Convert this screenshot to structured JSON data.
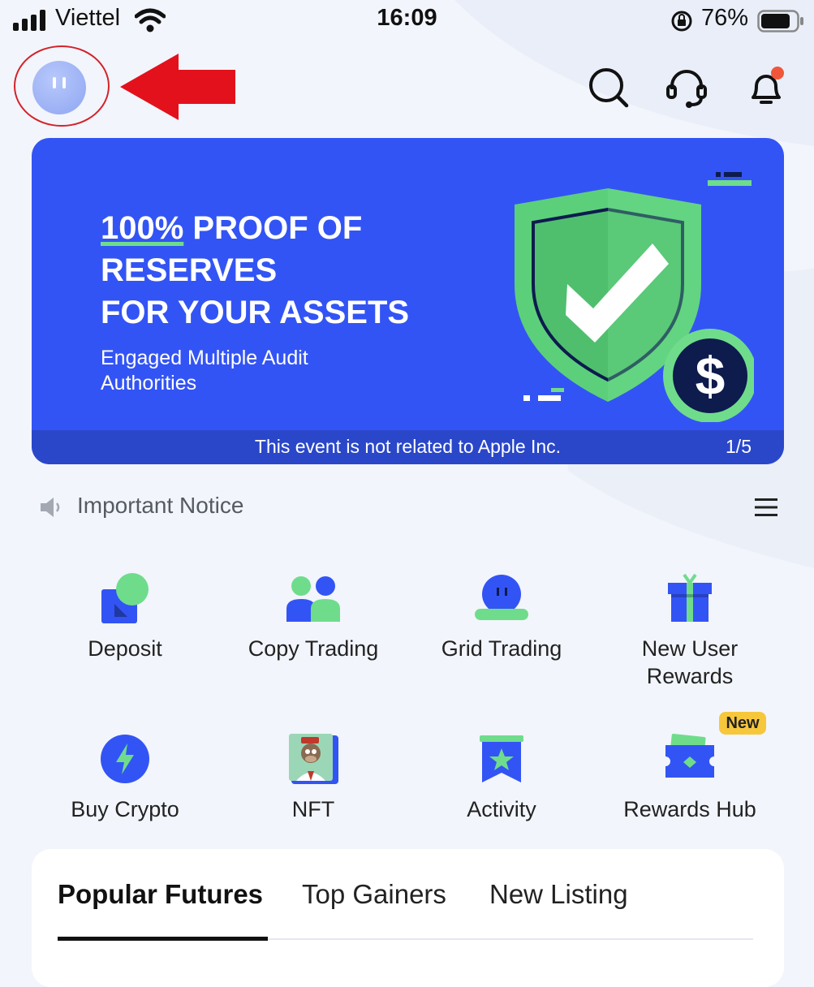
{
  "status_bar": {
    "carrier": "Viettel",
    "time": "16:09",
    "battery_percent": "76%",
    "icons": [
      "signal-icon",
      "wifi-icon",
      "rotation-lock-icon",
      "battery-icon"
    ]
  },
  "header": {
    "avatar_icon": "avatar-icon",
    "annotation_arrow_color": "#e3111b",
    "icons": [
      "search-icon",
      "customer-support-icon",
      "notification-bell-icon"
    ]
  },
  "banner": {
    "title_highlight": "100%",
    "title_line1_rest": " PROOF OF",
    "title_line2": "RESERVES",
    "title_line3": "FOR YOUR ASSETS",
    "subtitle": "Engaged Multiple Audit Authorities",
    "disclaimer": "This event is not related to Apple Inc.",
    "page_indicator": "1/5",
    "background_color": "#3354f4",
    "accent_color": "#6fdc8c"
  },
  "notice": {
    "label": "Important Notice"
  },
  "quick_actions": [
    {
      "label": "Deposit",
      "icon": "deposit-icon"
    },
    {
      "label": "Copy Trading",
      "icon": "copy-trading-icon"
    },
    {
      "label": "Grid Trading",
      "icon": "grid-trading-icon"
    },
    {
      "label": "New User Rewards",
      "icon": "gift-icon"
    },
    {
      "label": "Buy Crypto",
      "icon": "lightning-icon"
    },
    {
      "label": "NFT",
      "icon": "nft-icon"
    },
    {
      "label": "Activity",
      "icon": "activity-star-icon"
    },
    {
      "label": "Rewards Hub",
      "icon": "ticket-icon",
      "badge": "New"
    }
  ],
  "market": {
    "tabs": [
      {
        "label": "Popular Futures",
        "active": true
      },
      {
        "label": "Top Gainers",
        "active": false
      },
      {
        "label": "New Listing",
        "active": false
      }
    ]
  }
}
